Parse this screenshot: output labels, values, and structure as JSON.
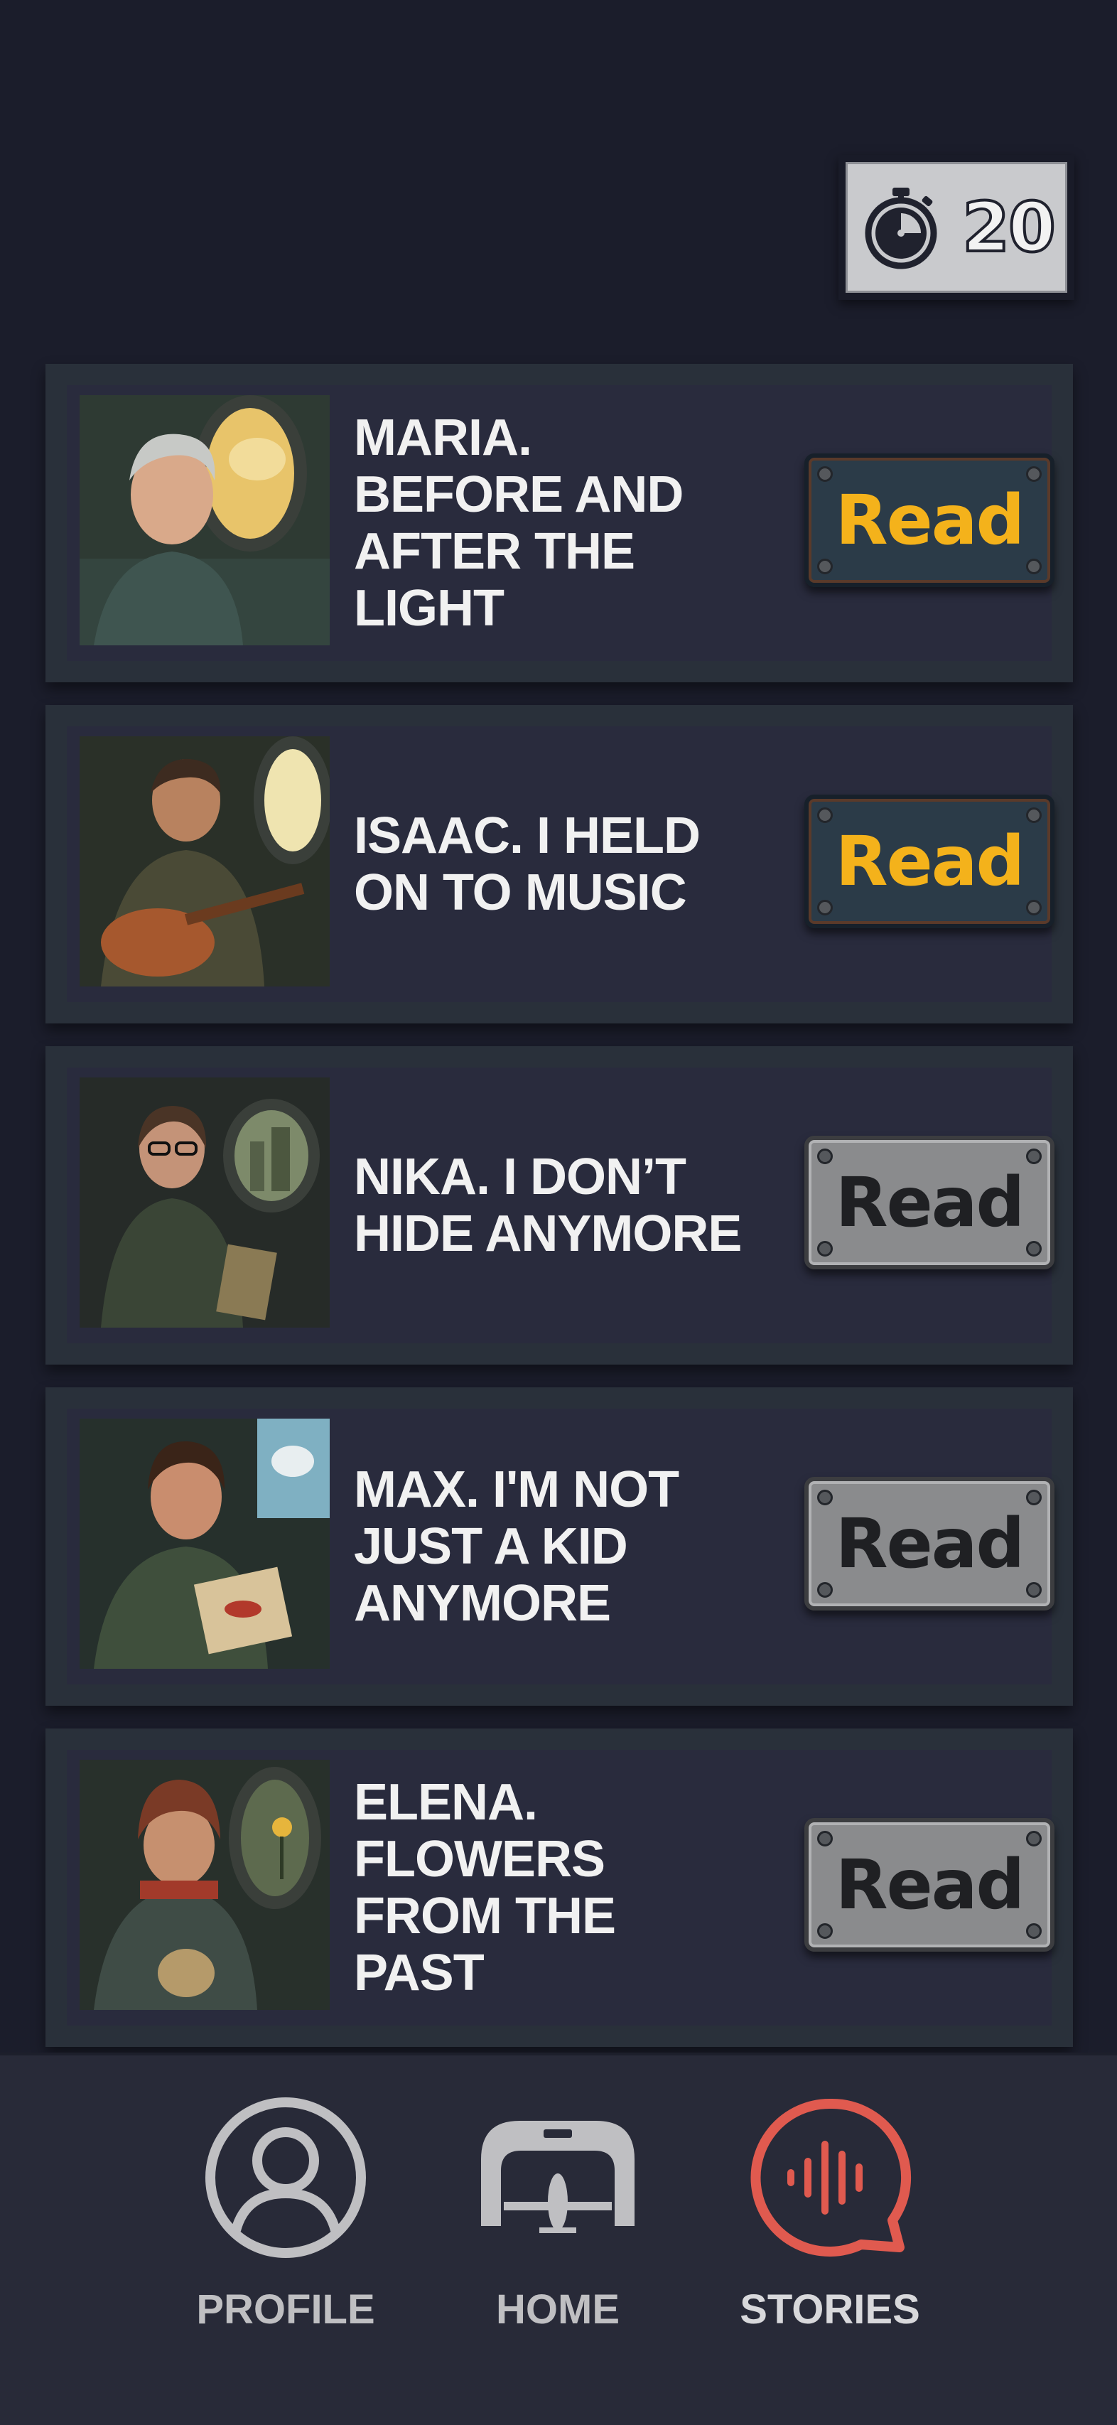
{
  "timer": {
    "icon": "stopwatch-icon",
    "value": "20"
  },
  "stories": [
    {
      "title": "Maria. Before and after the light",
      "button": "Read",
      "state": "unlocked",
      "portrait": "elderly woman at airplane window"
    },
    {
      "title": "Isaac. I held on to music",
      "button": "Read",
      "state": "unlocked",
      "portrait": "man with guitar at airplane window"
    },
    {
      "title": "Nika. I don’t hide anymore",
      "button": "Read",
      "state": "locked",
      "portrait": "woman with glasses holding a book"
    },
    {
      "title": "Max. I'm not just a kid anymore",
      "button": "Read",
      "state": "locked",
      "portrait": "boy holding a drawing"
    },
    {
      "title": "Elena. Flowers from the past",
      "button": "Read",
      "state": "locked",
      "portrait": "woman in knit hat with flower outside window"
    }
  ],
  "nav": {
    "profile_label": "PROFILE",
    "home_label": "HOME",
    "stories_label": "STORIES",
    "active": "stories"
  },
  "colors": {
    "background": "#1b1d2b",
    "card": "#292b3d",
    "card_border": "#29303a",
    "read_active_text": "#f4b21b",
    "read_locked_bg": "#8a8b8d",
    "nav_active": "#e05a4f"
  }
}
